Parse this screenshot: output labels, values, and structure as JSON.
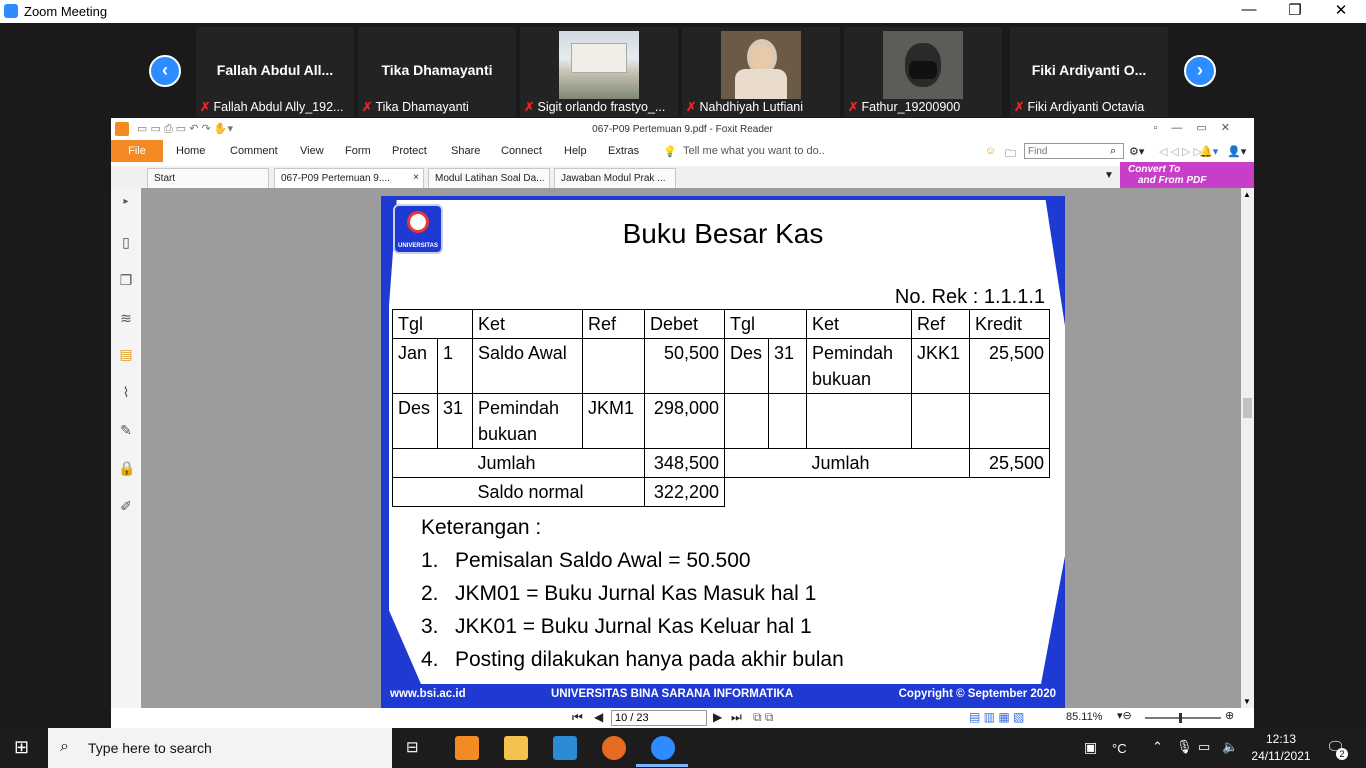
{
  "zoom": {
    "window_title": "Zoom Meeting",
    "controls": {
      "minimize": "—",
      "restore": "❐",
      "close": "✕"
    },
    "prev_arrow": "‹",
    "next_arrow": "›",
    "tiles": [
      {
        "big_name": "Fallah Abdul All...",
        "label": "Fallah Abdul Ally_192...",
        "has_video": false
      },
      {
        "big_name": "Tika Dhamayanti",
        "label": "Tika Dhamayanti",
        "has_video": false
      },
      {
        "big_name": "",
        "label": "Sigit orlando frastyo_...",
        "has_video": true
      },
      {
        "big_name": "",
        "label": "Nahdhiyah Lutfiani",
        "has_video": true
      },
      {
        "big_name": "",
        "label": "Fathur_19200900",
        "has_video": true
      },
      {
        "big_name": "Fiki Ardiyanti O...",
        "label": "Fiki Ardiyanti Octavia",
        "has_video": false
      }
    ],
    "muted_icon": "mic-muted-icon"
  },
  "foxit": {
    "title": "067-P09 Pertemuan 9.pdf - Foxit Reader",
    "menu": [
      "File",
      "Home",
      "Comment",
      "View",
      "Form",
      "Protect",
      "Share",
      "Connect",
      "Help",
      "Extras"
    ],
    "tell_me": "Tell me what you want to do..",
    "find_placeholder": "Find",
    "tabs": [
      "Start",
      "067-P09 Pertemuan 9....",
      "Modul Latihan Soal Da...",
      "Jawaban Modul Prak ..."
    ],
    "tab_close": "×",
    "convert_line1": "Convert To",
    "convert_line2": "and From PDF",
    "page_field": "10 / 23",
    "zoom_level": "85.11%",
    "accent_color": "#f48a23"
  },
  "slide": {
    "title": "Buku Besar Kas",
    "account_no": "No. Rek : 1.1.1.1",
    "logo_text": "UNIVERSITAS",
    "headers": [
      "Tgl",
      "Ket",
      "Ref",
      "Debet",
      "Tgl",
      "Ket",
      "Ref",
      "Kredit"
    ],
    "row1": [
      "Jan",
      "1",
      "Saldo Awal",
      "",
      "50,500",
      "Des",
      "31",
      "Pemindah bukuan",
      "JKK1",
      "25,500"
    ],
    "row2": [
      "Des",
      "31",
      "Pemindah bukuan",
      "JKM1",
      "298,000"
    ],
    "total_label": "Jumlah",
    "total_debet": "348,500",
    "total_label_right": "Jumlah",
    "total_kredit": "25,500",
    "saldo_label": "Saldo normal",
    "saldo_value": "322,200",
    "notes_heading": "Keterangan :",
    "notes": [
      {
        "n": "1.",
        "text": "Pemisalan Saldo Awal = 50.500"
      },
      {
        "n": "2.",
        "text": "JKM01 = Buku Jurnal Kas Masuk hal 1"
      },
      {
        "n": "3.",
        "text": "JKK01 = Buku Jurnal Kas Keluar hal 1"
      },
      {
        "n": "4.",
        "text": "Posting dilakukan hanya pada akhir bulan"
      }
    ],
    "footer_left": "www.bsi.ac.id",
    "footer_center": "UNIVERSITAS BINA SARANA INFORMATIKA",
    "footer_right": "Copyright © September 2020",
    "brand_color": "#1f3ad2"
  },
  "taskbar": {
    "search_placeholder": "Type here to search",
    "temp_unit": "°C",
    "time": "12:13",
    "date": "24/11/2021",
    "notifications": "2"
  }
}
